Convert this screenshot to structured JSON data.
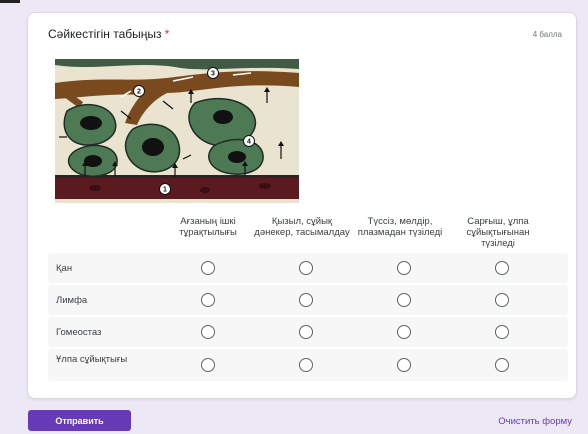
{
  "question": {
    "title": "Сәйкестігін табыңыз",
    "required_mark": "*",
    "points": "4 балла"
  },
  "illustration": {
    "markers": [
      "1",
      "2",
      "3",
      "4"
    ]
  },
  "grid": {
    "columns": [
      "Ағзаның ішкі тұрақтылығы",
      "Қызыл, сұйық дәнекер, тасымалдау",
      "Түссіз, мөлдір, плазмадан түзіледі",
      "Сарғыш, ұлпа сұйықтығынан түзіледі"
    ],
    "rows": [
      "Қан",
      "Лимфа",
      "Гомеостаз",
      "Ұлпа сұйықтығы"
    ]
  },
  "actions": {
    "submit_label": "Отправить",
    "clear_label": "Очистить форму"
  },
  "colors": {
    "accent": "#673ab7",
    "required": "#d93025",
    "page_bg": "#ece8f5"
  }
}
